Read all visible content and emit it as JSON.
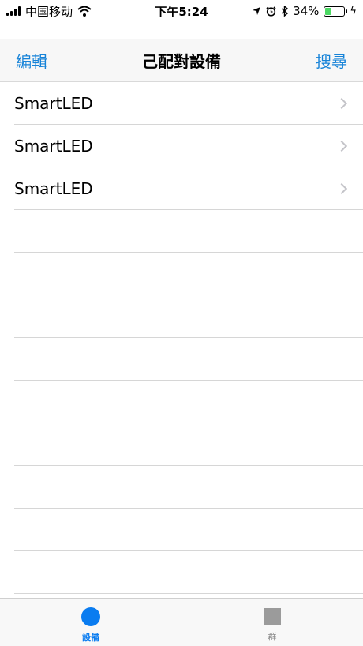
{
  "status_bar": {
    "carrier": "中国移动",
    "time": "下午5:24",
    "battery_percent": "34%",
    "battery_level": 0.34,
    "icons": [
      "signal-icon",
      "wifi-icon",
      "location-icon",
      "alarm-icon",
      "bluetooth-icon",
      "battery-icon",
      "charging-icon"
    ]
  },
  "nav": {
    "left_button": "編輯",
    "title": "己配對設備",
    "right_button": "搜尋"
  },
  "devices": [
    {
      "name": "SmartLED"
    },
    {
      "name": "SmartLED"
    },
    {
      "name": "SmartLED"
    }
  ],
  "tabs": [
    {
      "label": "設備",
      "active": true,
      "icon": "circle-icon"
    },
    {
      "label": "群",
      "active": false,
      "icon": "square-icon"
    }
  ],
  "colors": {
    "accent": "#1683d8",
    "tab_active": "#0a7cf0",
    "tab_inactive": "#9b9b9b",
    "battery": "#4cd964"
  }
}
